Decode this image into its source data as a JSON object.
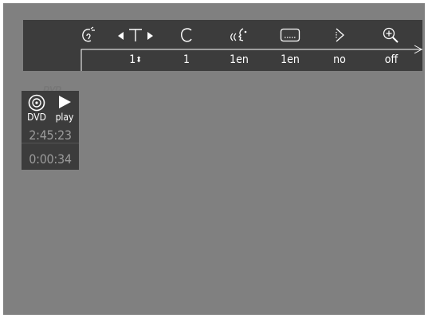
{
  "menu_bar": {
    "items": [
      {
        "icon": "disc-menu-icon",
        "value": ""
      },
      {
        "icon": "title-icon",
        "value": "1"
      },
      {
        "icon": "chapter-icon",
        "value": "1"
      },
      {
        "icon": "audio-language-icon",
        "value": "1en"
      },
      {
        "icon": "subtitle-icon",
        "value": "1en"
      },
      {
        "icon": "angle-icon",
        "value": "no"
      },
      {
        "icon": "zoom-icon",
        "value": "off"
      }
    ],
    "title_value": "1",
    "title_updown_glyph": "⬍",
    "disc_logo": "DVD"
  },
  "status_panel": {
    "media_label": "DVD",
    "state_label": "play",
    "total_time": "2:45:23",
    "elapsed_time": "0:00:34"
  },
  "colors": {
    "screen_bg": "#808080",
    "panel_bg": "#3c3c3c",
    "text": "#ffffff",
    "time_text": "#9a9a9a"
  }
}
